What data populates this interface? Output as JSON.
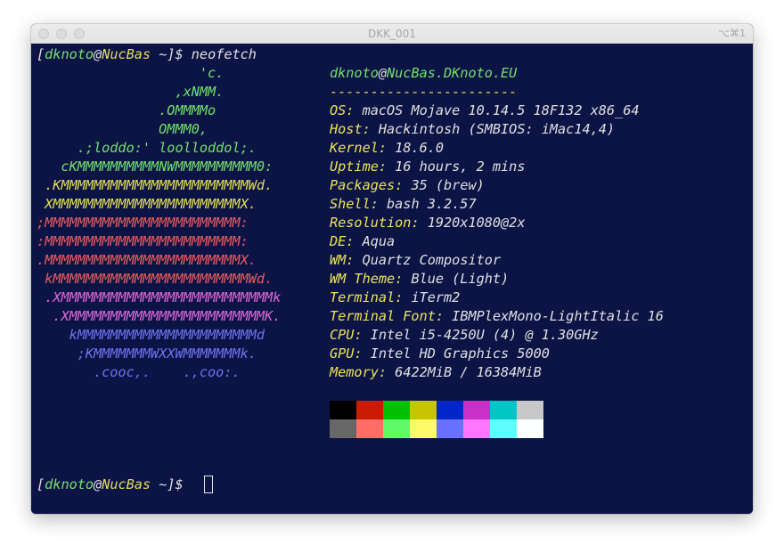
{
  "window": {
    "title": "DKK_001",
    "shortcut": "⌥⌘1",
    "traffic_lights": [
      "close",
      "minimize",
      "zoom"
    ]
  },
  "colors": {
    "background": "#0c1446",
    "green": "#71e26a",
    "yellow": "#e4de56",
    "red": "#ec5c5c",
    "magenta": "#e068d9",
    "blue": "#6e74ef"
  },
  "prompt": {
    "open": "[",
    "user": "dknoto",
    "at": "@",
    "host": "NucBas",
    "path": " ~]$ ",
    "command": "neofetch"
  },
  "logo": [
    {
      "text": "                    'c.",
      "color": "green"
    },
    {
      "text": "                 ,xNMM.",
      "color": "green"
    },
    {
      "text": "               .OMMMMo",
      "color": "green"
    },
    {
      "text": "               OMMM0,",
      "color": "green"
    },
    {
      "text": "     .;loddo:' loolloddol;.",
      "color": "green"
    },
    {
      "text": "   cKMMMMMMMMMMNWMMMMMMMMMM0:",
      "color": "green"
    },
    {
      "text": " .KMMMMMMMMMMMMMMMMMMMMMMMWd.",
      "color": "yellow"
    },
    {
      "text": " XMMMMMMMMMMMMMMMMMMMMMMMX.",
      "color": "yellow"
    },
    {
      "text": ";MMMMMMMMMMMMMMMMMMMMMMMM:",
      "color": "red"
    },
    {
      "text": ":MMMMMMMMMMMMMMMMMMMMMMMM:",
      "color": "red"
    },
    {
      "text": ".MMMMMMMMMMMMMMMMMMMMMMMMX.",
      "color": "red"
    },
    {
      "text": " kMMMMMMMMMMMMMMMMMMMMMMMMWd.",
      "color": "red"
    },
    {
      "text": " .XMMMMMMMMMMMMMMMMMMMMMMMMMMk",
      "color": "magenta"
    },
    {
      "text": "  .XMMMMMMMMMMMMMMMMMMMMMMMMK.",
      "color": "magenta"
    },
    {
      "text": "    kMMMMMMMMMMMMMMMMMMMMMMd",
      "color": "blue"
    },
    {
      "text": "     ;KMMMMMMMWXXWMMMMMMMk.",
      "color": "blue"
    },
    {
      "text": "       .cooc,.    .,coo:.",
      "color": "blue"
    }
  ],
  "header": {
    "user": "dknoto",
    "at": "@",
    "host": "NucBas.DKnoto.EU",
    "separator": "-----------------------"
  },
  "info": [
    {
      "label": "OS",
      "value": "macOS Mojave 10.14.5 18F132 x86_64"
    },
    {
      "label": "Host",
      "value": "Hackintosh (SMBIOS: iMac14,4)"
    },
    {
      "label": "Kernel",
      "value": "18.6.0"
    },
    {
      "label": "Uptime",
      "value": "16 hours, 2 mins"
    },
    {
      "label": "Packages",
      "value": "35 (brew)"
    },
    {
      "label": "Shell",
      "value": "bash 3.2.57"
    },
    {
      "label": "Resolution",
      "value": "1920x1080@2x"
    },
    {
      "label": "DE",
      "value": "Aqua"
    },
    {
      "label": "WM",
      "value": "Quartz Compositor"
    },
    {
      "label": "WM Theme",
      "value": "Blue (Light)"
    },
    {
      "label": "Terminal",
      "value": "iTerm2"
    },
    {
      "label": "Terminal Font",
      "value": "IBMPlexMono-LightItalic 16"
    },
    {
      "label": "CPU",
      "value": "Intel i5-4250U (4) @ 1.30GHz"
    },
    {
      "label": "GPU",
      "value": "Intel HD Graphics 5000"
    },
    {
      "label": "Memory",
      "value": "6422MiB / 16384MiB"
    }
  ],
  "palette": {
    "normal": [
      "#000000",
      "#c91b00",
      "#00c200",
      "#c7c400",
      "#0225c7",
      "#c930c7",
      "#00c5c7",
      "#c7c7c7"
    ],
    "bright": [
      "#676767",
      "#ff6d67",
      "#5ff967",
      "#fefb67",
      "#6871ff",
      "#ff76ff",
      "#5ffdff",
      "#feffff"
    ]
  }
}
